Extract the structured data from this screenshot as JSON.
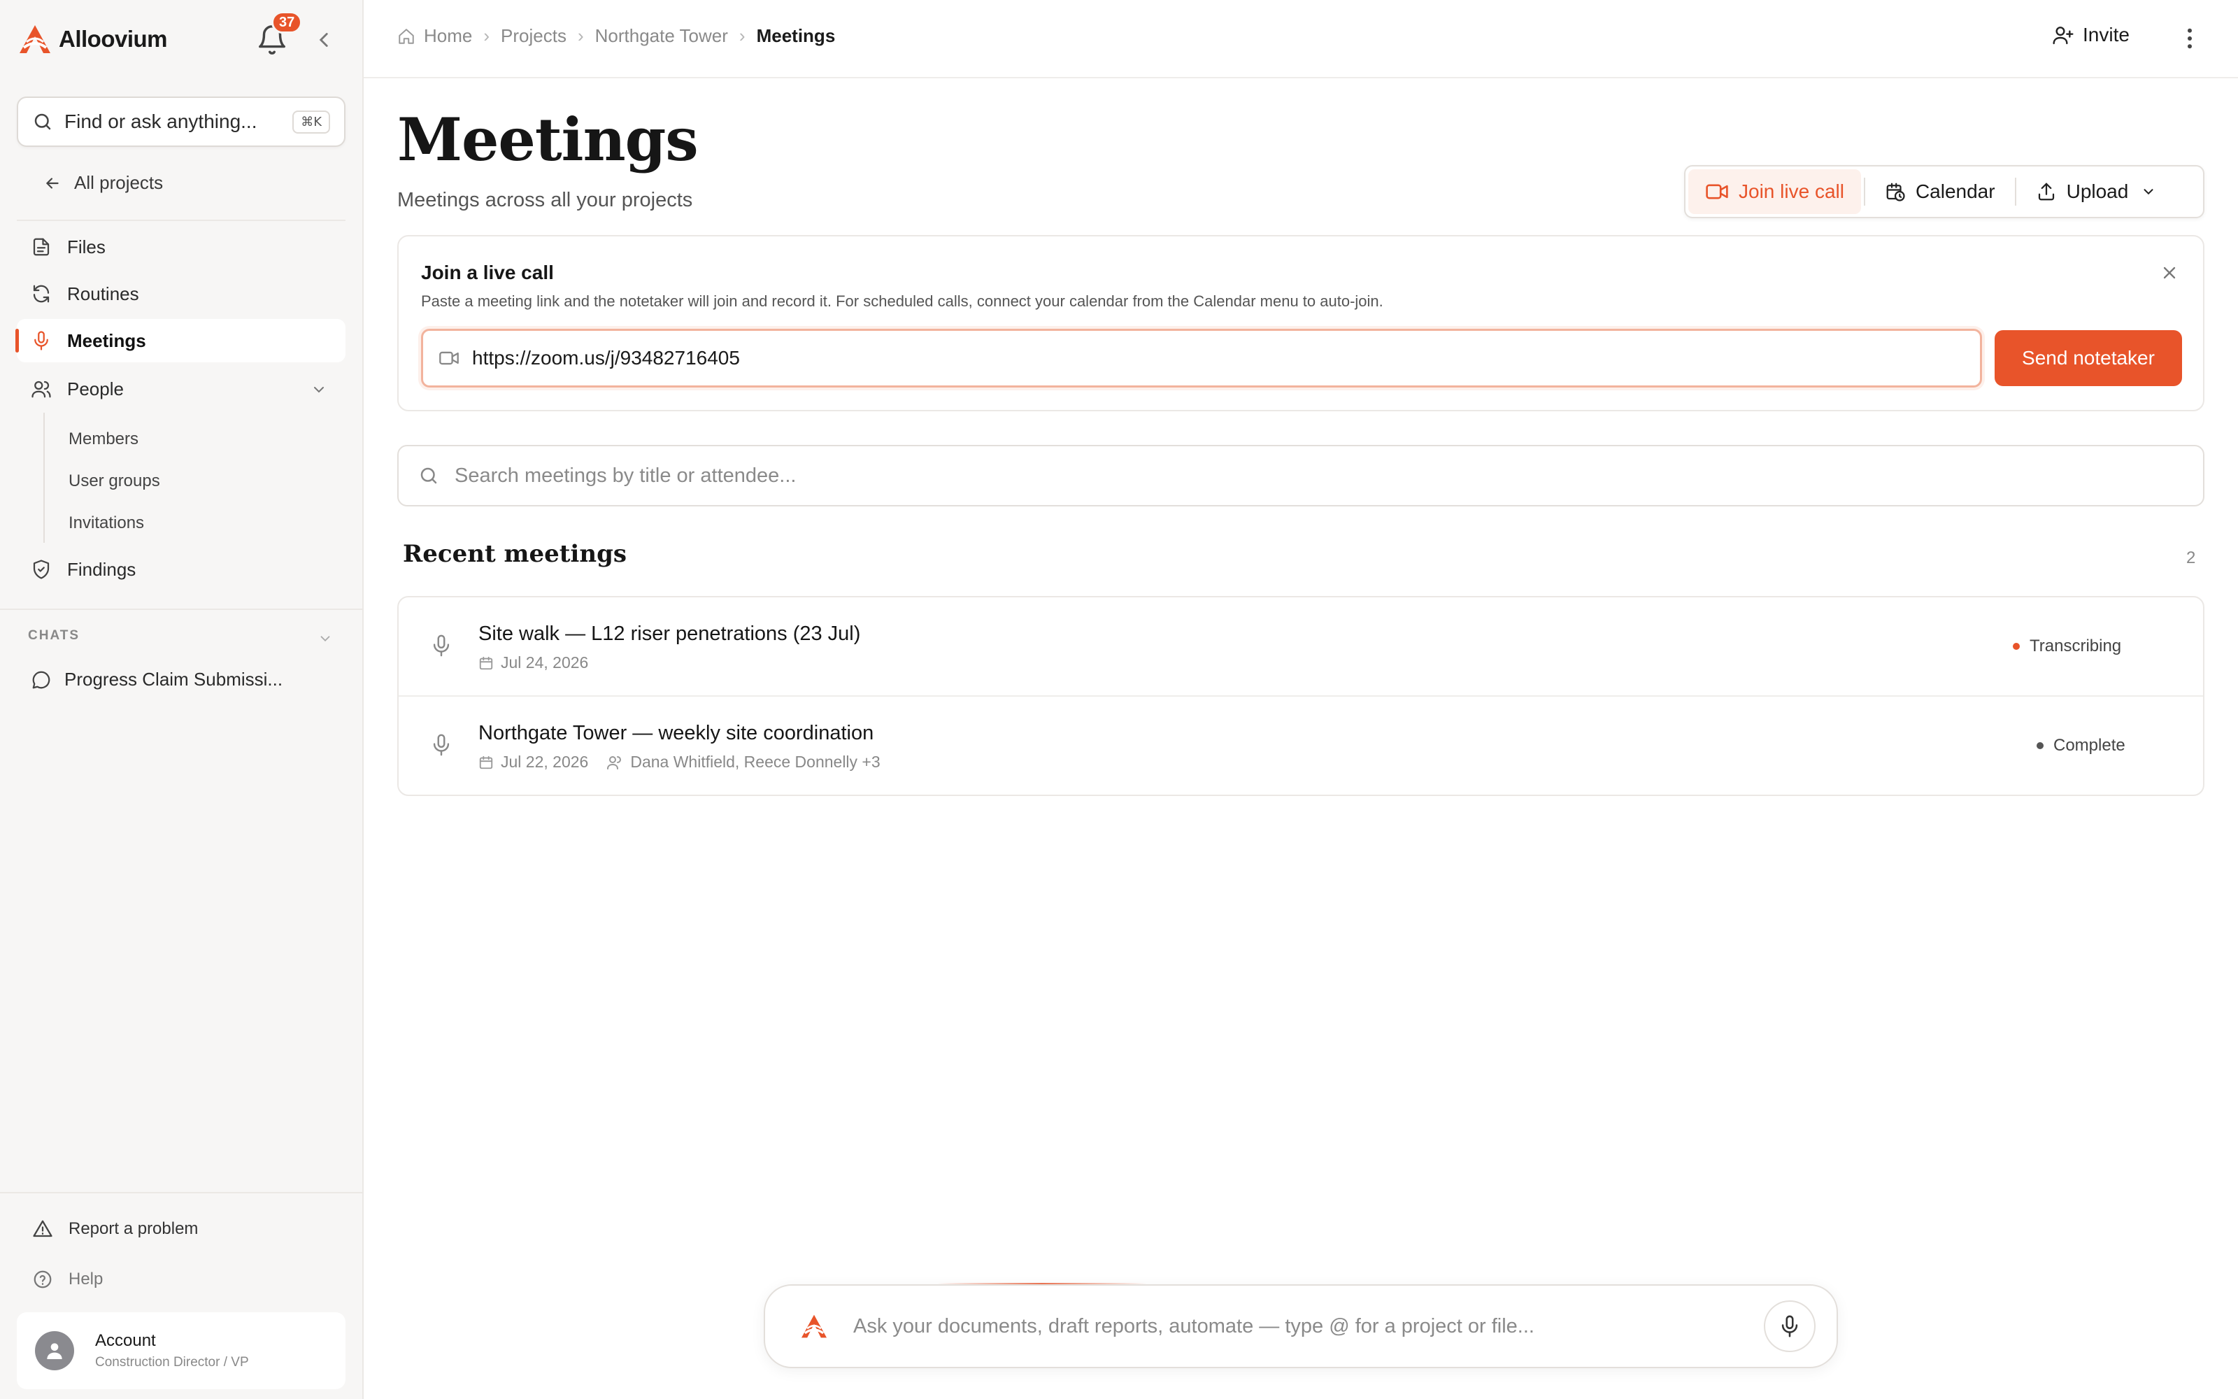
{
  "brand": {
    "name": "Alloovium",
    "accent": "#e8542a"
  },
  "notifications": {
    "count": "37"
  },
  "sidebar": {
    "search_placeholder": "Find or ask anything...",
    "search_shortcut": "⌘K",
    "back_label": "All projects",
    "nav": [
      {
        "label": "Files",
        "icon": "file-icon"
      },
      {
        "label": "Routines",
        "icon": "refresh-icon"
      },
      {
        "label": "Meetings",
        "icon": "mic-icon",
        "active": true
      },
      {
        "label": "People",
        "icon": "users-icon",
        "expanded": true
      }
    ],
    "people_sub": [
      "Members",
      "User groups",
      "Invitations"
    ],
    "findings_label": "Findings",
    "chats_header": "CHATS",
    "chats": [
      "Progress Claim Submissi..."
    ],
    "report_label": "Report a problem",
    "help_label": "Help",
    "account": {
      "name": "Account",
      "role": "Construction Director / VP"
    }
  },
  "breadcrumb": [
    "Home",
    "Projects",
    "Northgate Tower",
    "Meetings"
  ],
  "topbar": {
    "invite_label": "Invite"
  },
  "page": {
    "title": "Meetings",
    "subtitle": "Meetings across all your projects"
  },
  "actions": {
    "join_label": "Join live call",
    "calendar_label": "Calendar",
    "upload_label": "Upload"
  },
  "live_call": {
    "title": "Join a live call",
    "description": "Paste a meeting link and the notetaker will join and record it. For scheduled calls, connect your calendar from the Calendar menu to auto-join.",
    "url_value": "https://zoom.us/j/93482716405",
    "send_label": "Send notetaker"
  },
  "meeting_search": {
    "placeholder": "Search meetings by title or attendee..."
  },
  "recent": {
    "title": "Recent meetings",
    "count": "2",
    "items": [
      {
        "title": "Site walk — L12 riser penetrations (23 Jul)",
        "date": "Jul 24, 2026",
        "attendees": "",
        "status": "Transcribing",
        "status_color": "#e8542a"
      },
      {
        "title": "Northgate Tower — weekly site coordination",
        "date": "Jul 22, 2026",
        "attendees": "Dana Whitfield, Reece Donnelly +3",
        "status": "Complete",
        "status_color": "#555555"
      }
    ]
  },
  "composer": {
    "placeholder": "Ask your documents, draft reports, automate — type @ for a project or file..."
  }
}
